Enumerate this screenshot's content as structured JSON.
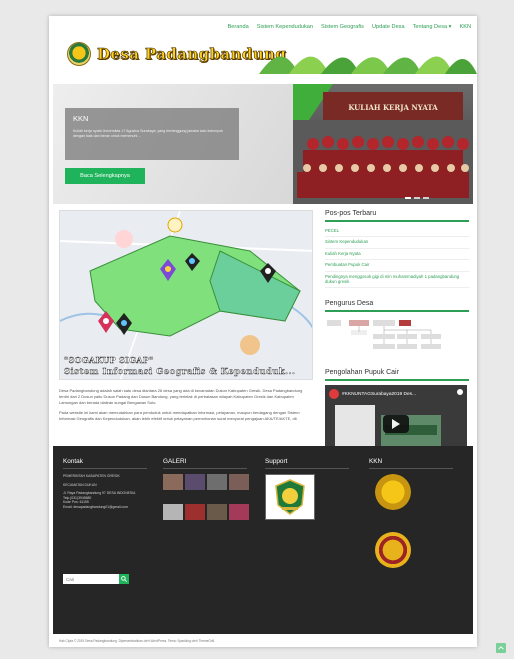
{
  "nav": {
    "items": [
      "Beranda",
      "Sistem Kependudukan",
      "Sistem Geografis",
      "Update Desa",
      "Tentang Desa ▾",
      "KKN"
    ]
  },
  "header": {
    "site_title": "Desa Padangbandung"
  },
  "hero": {
    "caption_title": "KKN",
    "caption_text": "Kuliah kerja nyata Universitas 17 Agustus Surabaya, yang bertanggung jawaba satu kelompok dengan baik dan benar untuk memenuhi ...",
    "button": "Baca Selengkapnya",
    "banner_text": "KULIAH KERJA NYATA"
  },
  "main": {
    "gis_title": "\"SOGAKUP SIGAP\"",
    "gis_subtitle": "Sistem Informasi Geografis & Kependuduk...",
    "about_p1": "Desa Padangbandung adalah salah satu desa diantara 26 desa yang ada di kecamatan Dukun Kabupaten Gresik. Desa Padangbandung terdiri dari 2 Dusun yaitu Dusun Padang dan Dusun Bandung, yang terletak di perbatasan wilayah Kabupaten Gresik dan Kabupaten Lamongan dan berada dialiran sungai Bengawan Solo.",
    "about_p2": "Pada website ini kami akan memudahkan para penduduk untuk mendapatkan informasi, pelayanan, maupun berdagang dengan Sistem Informasi Geografis dan Kependudukan, akan lebih efektif untuk pelayanan permohonan surat menyurat pengajuan AKA/TE/AKTE, dll."
  },
  "sidebar": {
    "recent_title": "Pos-pos Terbaru",
    "posts": [
      "PECEL",
      "Sistem Kependudukan",
      "Kuliah Kerja Nyata",
      "Pembuatan Pupuk Cair",
      "Pendingnya menggosok gigi di min muhammadiyah 1 padangbandung dukun gresik"
    ],
    "pengurus_title": "Pengurus Desa",
    "video_title": "Pengolahan Pupuk Cair",
    "video_label": "#KKNUNTAGSurabaya2019 Des...",
    "video_time": "00:00"
  },
  "footer": {
    "kontak_title": "Kontak",
    "kontak_lines": [
      "PEMERINTAH KABUPATEN GRESIK",
      "KECAMATAN DUKUN",
      "Jl. Raya Padangbandung 97 DESA INDONESIA",
      "Telp.(031)3945680",
      "Kode Pos: 61155",
      "Email: desapadangbandung01@gmail.com"
    ],
    "search_placeholder": "Cari",
    "galeri_title": "GALERI",
    "support_title": "Support",
    "kkn_title": "KKN",
    "copyright": "Hak Cipta © 2019 Desa Padangbandung. Dipersembahkan oleh WordPress. Tema: Sparkling oleh ThemeGrill."
  },
  "colors": {
    "accent": "#2e9e54",
    "button": "#1fb45c",
    "footer_bg": "#262626"
  }
}
